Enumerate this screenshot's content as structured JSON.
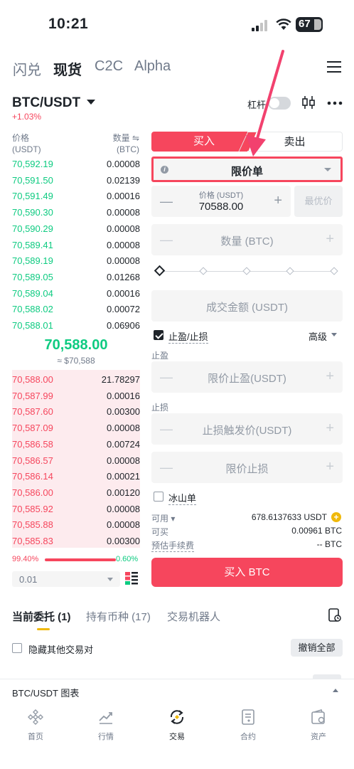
{
  "status_bar": {
    "time": "10:21",
    "battery": "67"
  },
  "top_tabs": [
    "闪兑",
    "现货",
    "C2C",
    "Alpha"
  ],
  "header": {
    "pair": "BTC/USDT",
    "change": "+1.03%",
    "leverage_label": "杠杆"
  },
  "order_book": {
    "price_header": "价格",
    "price_unit": "(USDT)",
    "qty_header": "数量 ⇋",
    "qty_unit": "(BTC)",
    "bids": [
      {
        "price": "70,592.19",
        "qty": "0.00008"
      },
      {
        "price": "70,591.50",
        "qty": "0.02139"
      },
      {
        "price": "70,591.49",
        "qty": "0.00016"
      },
      {
        "price": "70,590.30",
        "qty": "0.00008"
      },
      {
        "price": "70,590.29",
        "qty": "0.00008"
      },
      {
        "price": "70,589.41",
        "qty": "0.00008"
      },
      {
        "price": "70,589.19",
        "qty": "0.00008"
      },
      {
        "price": "70,589.05",
        "qty": "0.01268"
      },
      {
        "price": "70,589.04",
        "qty": "0.00016"
      },
      {
        "price": "70,588.02",
        "qty": "0.00072"
      },
      {
        "price": "70,588.01",
        "qty": "0.06906"
      }
    ],
    "mid_price": "70,588.00",
    "mid_fiat": "≈ $70,588",
    "asks": [
      {
        "price": "70,588.00",
        "qty": "21.78297"
      },
      {
        "price": "70,587.99",
        "qty": "0.00016"
      },
      {
        "price": "70,587.60",
        "qty": "0.00300"
      },
      {
        "price": "70,587.09",
        "qty": "0.00008"
      },
      {
        "price": "70,586.58",
        "qty": "0.00724"
      },
      {
        "price": "70,586.57",
        "qty": "0.00008"
      },
      {
        "price": "70,586.14",
        "qty": "0.00021"
      },
      {
        "price": "70,586.00",
        "qty": "0.00120"
      },
      {
        "price": "70,585.92",
        "qty": "0.00008"
      },
      {
        "price": "70,585.88",
        "qty": "0.00008"
      },
      {
        "price": "70,585.83",
        "qty": "0.00300"
      }
    ],
    "ratio_left": "99.40%",
    "ratio_right": "0.60%",
    "precision": "0.01"
  },
  "order_form": {
    "buy_tab": "买入",
    "sell_tab": "卖出",
    "order_type": "限价单",
    "price_label": "价格 (USDT)",
    "price_value": "70588.00",
    "best_price": "最优价",
    "quantity_placeholder": "数量 (BTC)",
    "total_placeholder": "成交金额 (USDT)",
    "tpsl_label": "止盈/止损",
    "advanced": "高级",
    "tp_label": "止盈",
    "tp_placeholder": "限价止盈(USDT)",
    "sl_label": "止损",
    "sl_trigger_placeholder": "止损触发价(USDT)",
    "sl_limit_placeholder": "限价止损",
    "iceberg": "冰山单",
    "available_label": "可用",
    "available_value": "678.6137633 USDT",
    "can_buy_label": "可买",
    "can_buy_value": "0.00961 BTC",
    "fee_label": "预估手续费",
    "fee_value": "-- BTC",
    "submit": "买入 BTC"
  },
  "orders_section": {
    "tabs": [
      "当前委托 (1)",
      "持有币种 (17)",
      "交易机器人"
    ],
    "hide_other_pairs": "隐藏其他交易对",
    "cancel_all": "撤销全部"
  },
  "chart_bar": {
    "title": "BTC/USDT 图表"
  },
  "bottom_nav": [
    "首页",
    "行情",
    "交易",
    "合约",
    "资产"
  ],
  "colors": {
    "buy": "#0ecb81",
    "sell": "#f6465d",
    "brand": "#f0b90b"
  }
}
